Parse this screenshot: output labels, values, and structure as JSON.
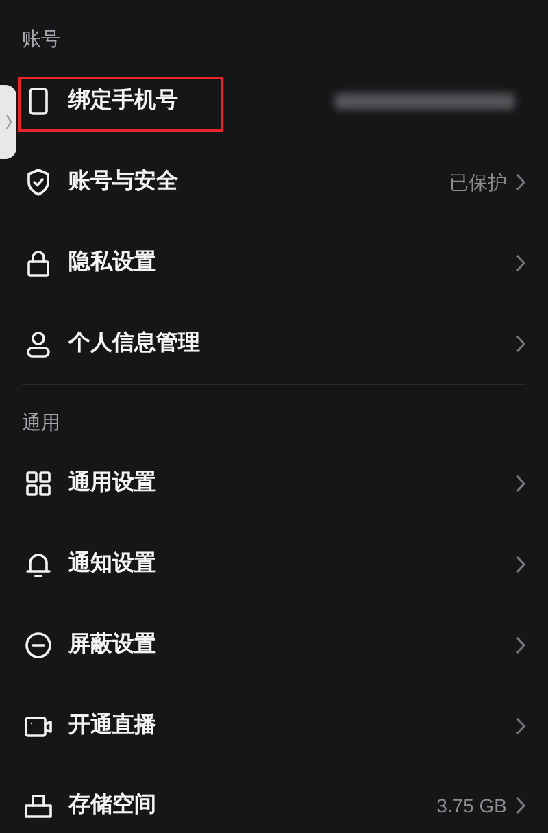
{
  "sections": [
    {
      "title": "账号",
      "items": [
        {
          "label": "绑定手机号",
          "value_blurred": true,
          "highlighted": true,
          "chevron": false
        },
        {
          "label": "账号与安全",
          "value": "已保护",
          "chevron": true
        },
        {
          "label": "隐私设置",
          "chevron": true
        },
        {
          "label": "个人信息管理",
          "chevron": true
        }
      ]
    },
    {
      "title": "通用",
      "items": [
        {
          "label": "通用设置",
          "chevron": true
        },
        {
          "label": "通知设置",
          "chevron": true
        },
        {
          "label": "屏蔽设置",
          "chevron": true
        },
        {
          "label": "开通直播",
          "chevron": true
        },
        {
          "label": "存储空间",
          "value": "3.75 GB",
          "chevron": true
        }
      ]
    }
  ]
}
